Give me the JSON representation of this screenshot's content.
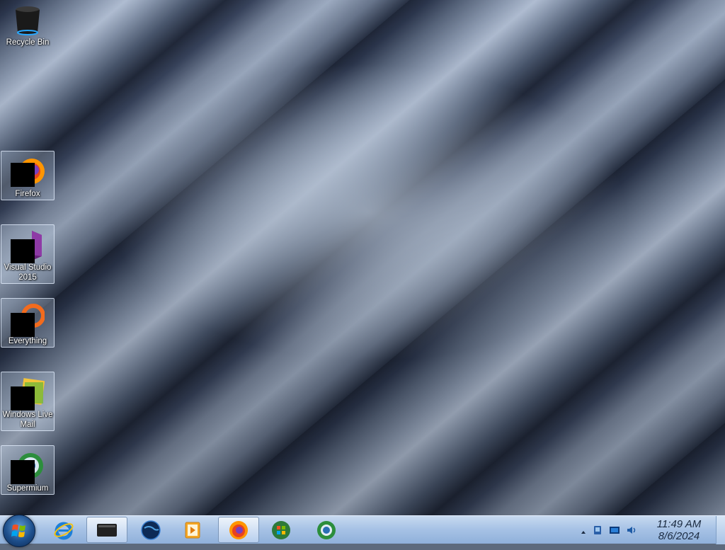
{
  "desktop": {
    "icons": [
      {
        "label": "Recycle Bin",
        "icon": "recycle-bin-icon"
      },
      {
        "label": "Firefox",
        "icon": "firefox-icon"
      },
      {
        "label": "Visual Studio 2015",
        "icon": "visual-studio-icon"
      },
      {
        "label": "Everything",
        "icon": "everything-icon"
      },
      {
        "label": "Windows Live Mail",
        "icon": "windows-live-mail-icon"
      },
      {
        "label": "Supermium",
        "icon": "supermium-icon"
      }
    ]
  },
  "taskbar": {
    "start_icon": "windows-start-orb-icon",
    "pinned": [
      {
        "icon": "internet-explorer-icon",
        "active": false
      },
      {
        "icon": "terminal-icon",
        "active": true
      },
      {
        "icon": "globe-icon",
        "active": false
      },
      {
        "icon": "media-player-icon",
        "active": false
      },
      {
        "icon": "firefox-icon",
        "active": true
      },
      {
        "icon": "windows-update-icon",
        "active": false
      },
      {
        "icon": "supermium-icon",
        "active": false
      }
    ],
    "tray": {
      "icons": [
        "show-hidden-icons-arrow",
        "network-icon",
        "display-icon",
        "volume-icon"
      ],
      "time": "11:49 AM",
      "date": "8/6/2024"
    }
  }
}
